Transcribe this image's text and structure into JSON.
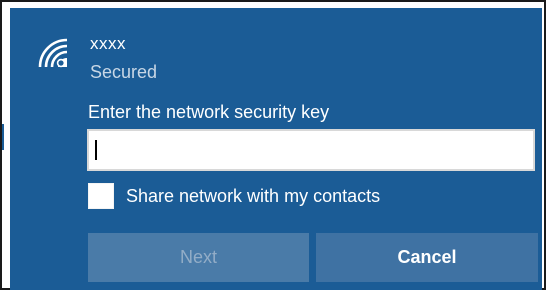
{
  "network": {
    "name": "xxxx",
    "status": "Secured",
    "icon": "wifi-secured-icon"
  },
  "security_key": {
    "label": "Enter the network security key",
    "value": ""
  },
  "share": {
    "label": "Share network with my contacts",
    "checked": false
  },
  "buttons": {
    "next_label": "Next",
    "cancel_label": "Cancel"
  },
  "colors": {
    "panel_background": "#1b5c96",
    "next_disabled": "#4a7ba8",
    "cancel_background": "#3f72a3"
  }
}
